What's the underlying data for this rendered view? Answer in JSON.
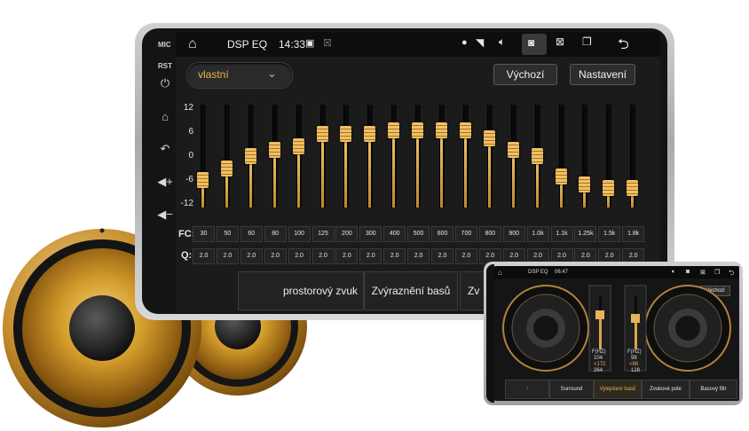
{
  "statusbar": {
    "title": "DSP EQ",
    "time": "14:33",
    "icons": [
      "home-icon",
      "image-icon",
      "cancel-icon",
      "location-icon",
      "wifi-icon",
      "volume-icon",
      "screenshot-icon",
      "close-window-icon",
      "multi-window-icon",
      "back-icon"
    ]
  },
  "side_buttons": {
    "mic": "MIC",
    "rst": "RST"
  },
  "equalizer": {
    "preset": "vlastní",
    "default_button": "Výchozí",
    "settings_button": "Nastavení",
    "y_ticks": [
      "12",
      "6",
      "0",
      "-6",
      "-12"
    ],
    "ylim": [
      -12,
      12
    ],
    "fc_label": "FC:",
    "q_label": "Q:",
    "frequencies": [
      "30",
      "50",
      "60",
      "80",
      "100",
      "125",
      "200",
      "300",
      "400",
      "500",
      "600",
      "700",
      "800",
      "900",
      "1.0k",
      "1.1k",
      "1.25k",
      "1.5k",
      "1.8k"
    ],
    "gains": [
      -6,
      -3,
      0,
      1.5,
      2.5,
      5.5,
      5.5,
      5.5,
      6.5,
      6.5,
      6.5,
      6.5,
      4.5,
      1.5,
      0,
      -5,
      -7,
      -8,
      -8
    ],
    "q_values": [
      "2.0",
      "2.0",
      "2.0",
      "2.0",
      "2.0",
      "2.0",
      "2.0",
      "2.0",
      "2.0",
      "2.0",
      "2.0",
      "2.0",
      "2.0",
      "2.0",
      "2.0",
      "2.0",
      "2.0",
      "2.0",
      "2.0"
    ],
    "accent": "#e0a94a"
  },
  "bottom_tabs": [
    "prostorový zvuk",
    "Zvýraznění basů",
    "Zv"
  ],
  "tablet": {
    "title": "DSP EQ",
    "time": "06:47",
    "default_button": "Výchozí",
    "panel_left": {
      "label": "F(HZ)",
      "values": [
        "104",
        "<172",
        "264"
      ]
    },
    "panel_right": {
      "label": "F(HZ)",
      "values": [
        "98",
        "<86",
        "128"
      ]
    },
    "tabs": [
      "",
      "Surround",
      "Vylepšení basů",
      "Zvukové pole",
      "Basový filtr"
    ]
  }
}
